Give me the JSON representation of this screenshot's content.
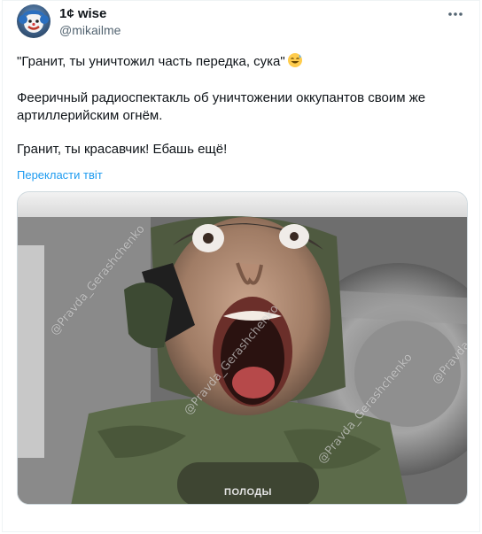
{
  "author": {
    "display_name": "1¢ wise",
    "handle": "@mikailme",
    "avatar_icon": "clown-avatar-icon"
  },
  "tweet": {
    "paragraphs": [
      "\"Гранит, ты уничтожил часть передка, сука\"",
      "Фееричный радиоспектакль об уничтожении оккупантов своим же артиллерийским огнём.",
      "Гранит, ты красавчик! Ебашь ещё!"
    ],
    "emoji": "sweat-smile-emoji",
    "translate_label": "Перекласти твіт"
  },
  "media": {
    "type": "video-still",
    "watermarks": [
      "@Pravda_Gerashchenko",
      "@Pravda_Gerashchenko",
      "@Pravda_Gerashchenko",
      "@Pravda_Gerashchenko"
    ],
    "patch_text": "ПОЛОДЫ"
  },
  "colors": {
    "link": "#1d9bf0",
    "secondary_text": "#536471",
    "primary_text": "#0f1419",
    "border": "#cfd9de"
  }
}
